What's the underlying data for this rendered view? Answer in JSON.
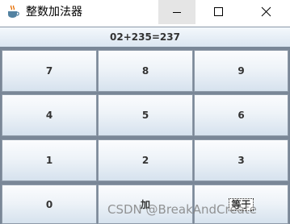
{
  "window": {
    "title": "整数加法器",
    "icon": "java-coffee-icon"
  },
  "display": {
    "text": "02+235=237"
  },
  "keypad": {
    "keys": [
      [
        "7",
        "8",
        "9"
      ],
      [
        "4",
        "5",
        "6"
      ],
      [
        "1",
        "2",
        "3"
      ],
      [
        "0",
        "加",
        "等于"
      ]
    ]
  },
  "watermark": {
    "text": "CSDN @BreakAndCreate"
  },
  "colors": {
    "button_top": "#fbfcfe",
    "button_bottom": "#d6e2ee",
    "grid_border": "#7a8797",
    "minimize_hover": "#e5e5e5"
  }
}
